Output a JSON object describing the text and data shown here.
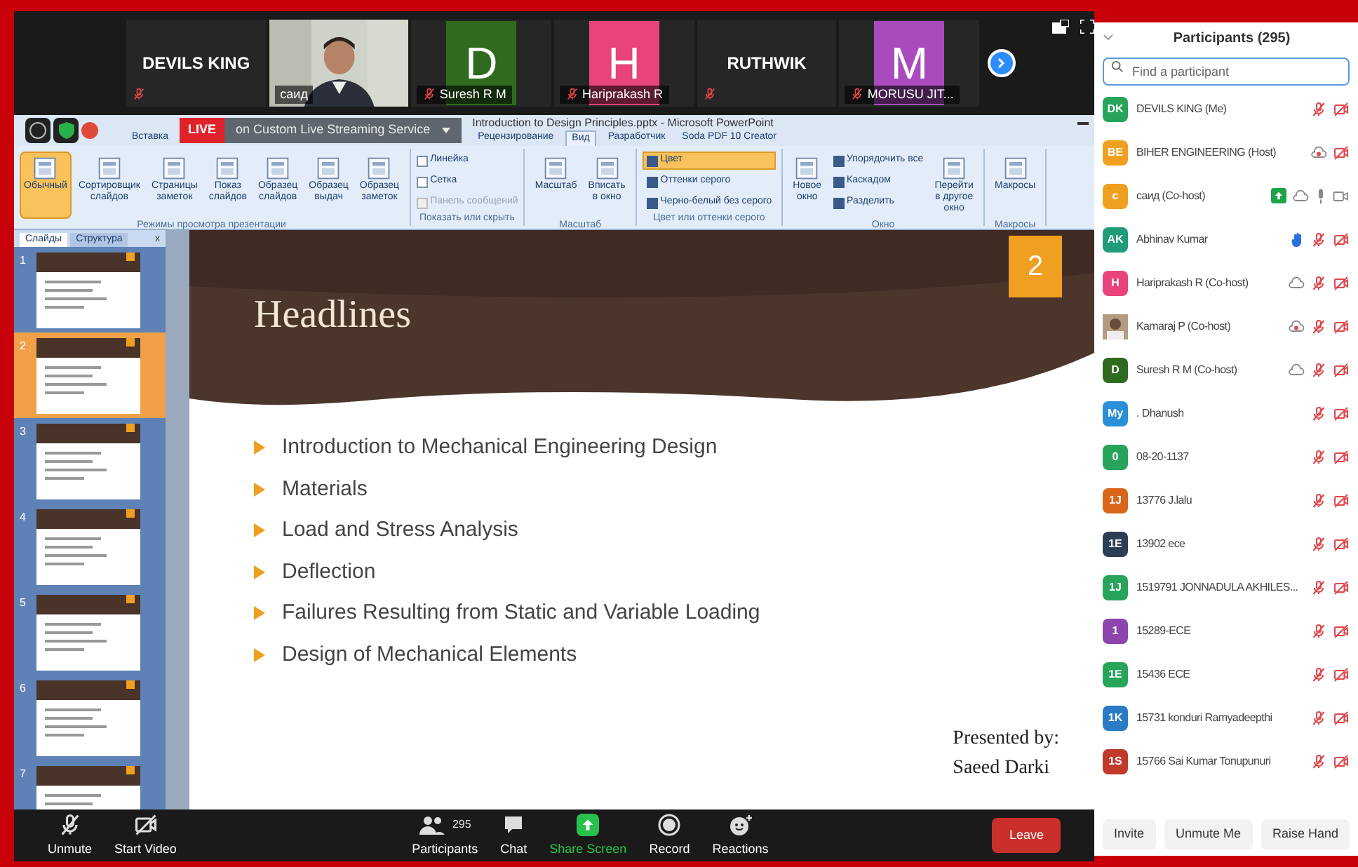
{
  "video_strip": {
    "tiles": [
      {
        "kind": "name",
        "name": "DEVILS KING",
        "muted": true
      },
      {
        "kind": "video",
        "label": "саид",
        "muted": false
      },
      {
        "kind": "letter",
        "letter": "D",
        "color": "#2e6b1e",
        "label": "Suresh R M",
        "muted": true
      },
      {
        "kind": "letter",
        "letter": "H",
        "color": "#e8437a",
        "label": "Hariprakash R",
        "muted": true
      },
      {
        "kind": "name",
        "name": "RUTHWIK",
        "muted": true
      },
      {
        "kind": "letter",
        "letter": "M",
        "color": "#a94bbd",
        "label": "MORUSU JIT...",
        "muted": true
      }
    ]
  },
  "powerpoint": {
    "title": "Introduction to Design Principles.pptx - Microsoft PowerPoint",
    "live_badge": "LIVE",
    "live_text": "on Custom Live Streaming Service",
    "tabs_before": [
      {
        "label": "Вставка",
        "selected": false
      }
    ],
    "tabs": [
      {
        "label": "Рецензирование",
        "selected": false
      },
      {
        "label": "Вид",
        "selected": true
      },
      {
        "label": "Разработчик",
        "selected": false
      },
      {
        "label": "Soda PDF 10 Creator",
        "selected": false
      }
    ],
    "ribbon": [
      {
        "label": "Режимы просмотра презентации",
        "items": [
          {
            "kind": "big",
            "label": "Обычный",
            "selected": true
          },
          {
            "kind": "big",
            "label": "Сортировщик слайдов",
            "selected": false
          },
          {
            "kind": "big",
            "label": "Страницы заметок",
            "selected": false
          },
          {
            "kind": "big",
            "label": "Показ слайдов",
            "selected": false
          },
          {
            "kind": "big",
            "label": "Образец слайдов",
            "selected": false
          },
          {
            "kind": "big",
            "label": "Образец выдач",
            "selected": false
          },
          {
            "kind": "big",
            "label": "Образец заметок",
            "selected": false
          }
        ]
      },
      {
        "label": "Показать или скрыть",
        "items": [
          {
            "kind": "check",
            "label": "Линейка",
            "checked": false,
            "disabled": false
          },
          {
            "kind": "check",
            "label": "Сетка",
            "checked": false,
            "disabled": false
          },
          {
            "kind": "check",
            "label": "Панель сообщений",
            "checked": false,
            "disabled": true
          }
        ]
      },
      {
        "label": "Масштаб",
        "items": [
          {
            "kind": "big",
            "label": "Масштаб",
            "selected": false
          },
          {
            "kind": "big",
            "label": "Вписать в окно",
            "selected": false
          }
        ]
      },
      {
        "label": "Цвет или оттенки серого",
        "items": [
          {
            "kind": "small",
            "label": "Цвет",
            "selected": true
          },
          {
            "kind": "small",
            "label": "Оттенки серого",
            "selected": false
          },
          {
            "kind": "small",
            "label": "Черно-белый без серого",
            "selected": false
          }
        ]
      },
      {
        "label": "Окно",
        "items": [
          {
            "kind": "big",
            "label": "Новое окно",
            "selected": false
          },
          {
            "kind": "small",
            "label": "Упорядочить все",
            "selected": false
          },
          {
            "kind": "small",
            "label": "Каскадом",
            "selected": false
          },
          {
            "kind": "small",
            "label": "Разделить",
            "selected": false
          },
          {
            "kind": "big",
            "label": "Перейти в другое окно",
            "selected": false
          }
        ]
      },
      {
        "label": "Макросы",
        "items": [
          {
            "kind": "big",
            "label": "Макросы",
            "selected": false
          }
        ]
      }
    ],
    "slide_panel": {
      "tabs": [
        {
          "label": "Слайды",
          "selected": true
        },
        {
          "label": "Структура",
          "selected": false
        }
      ],
      "close": "x",
      "thumbnails": [
        {
          "number": "1",
          "selected": false
        },
        {
          "number": "2",
          "selected": true
        },
        {
          "number": "3",
          "selected": false
        },
        {
          "number": "4",
          "selected": false
        },
        {
          "number": "5",
          "selected": false
        },
        {
          "number": "6",
          "selected": false
        },
        {
          "number": "7",
          "selected": false
        }
      ]
    },
    "slide": {
      "number": "2",
      "title": "Headlines",
      "bullets": [
        "Introduction to Mechanical Engineering Design",
        "Materials",
        "Load and Stress Analysis",
        "Deflection",
        "Failures Resulting from Static and Variable Loading",
        "Design of Mechanical Elements"
      ],
      "presented_by": "Presented by:",
      "author": "Saeed Darki"
    }
  },
  "toolbar": {
    "buttons": [
      {
        "kind": "unmute",
        "label": "Unmute"
      },
      {
        "kind": "video",
        "label": "Start Video"
      },
      {
        "kind": "participants",
        "label": "Participants",
        "count": "295"
      },
      {
        "kind": "chat",
        "label": "Chat"
      },
      {
        "kind": "share",
        "label": "Share Screen"
      },
      {
        "kind": "record",
        "label": "Record"
      },
      {
        "kind": "reactions",
        "label": "Reactions"
      }
    ],
    "leave": "Leave"
  },
  "participants_panel": {
    "title": "Participants (295)",
    "search": {
      "placeholder": "Find a participant"
    },
    "participants": [
      {
        "avatar": "DK",
        "color": "#27a35a",
        "name": "DEVILS KING (Me)",
        "status": [
          {
            "kind": "mic-off"
          },
          {
            "kind": "cam-off"
          }
        ]
      },
      {
        "avatar": "BE",
        "color": "#f0a020",
        "name": "BIHER ENGINEERING (Host)",
        "status": [
          {
            "kind": "rec"
          },
          {
            "kind": "cam-off"
          }
        ]
      },
      {
        "avatar": "c",
        "color": "#f0a020",
        "name": "саид (Co-host)",
        "status": [
          {
            "kind": "share"
          },
          {
            "kind": "cloud"
          },
          {
            "kind": "mic"
          },
          {
            "kind": "cam"
          }
        ]
      },
      {
        "avatar": "AK",
        "color": "#1f9c7a",
        "name": "Abhinav Kumar",
        "status": [
          {
            "kind": "hand"
          },
          {
            "kind": "mic-off"
          },
          {
            "kind": "cam-off"
          }
        ]
      },
      {
        "avatar": "H",
        "color": "#e8437a",
        "name": "Hariprakash R (Co-host)",
        "status": [
          {
            "kind": "cloud"
          },
          {
            "kind": "mic-off"
          },
          {
            "kind": "cam-off"
          }
        ]
      },
      {
        "name": "Kamaraj P (Co-host)",
        "status": [
          {
            "kind": "rec"
          },
          {
            "kind": "mic-off"
          },
          {
            "kind": "cam-off"
          }
        ]
      },
      {
        "avatar": "D",
        "color": "#2e6b1e",
        "name": "Suresh R M (Co-host)",
        "status": [
          {
            "kind": "cloud"
          },
          {
            "kind": "mic-off"
          },
          {
            "kind": "cam-off"
          }
        ]
      },
      {
        "avatar": "My",
        "color": "#2a8fd6",
        "name": ". Dhanush",
        "status": [
          {
            "kind": "mic-off"
          },
          {
            "kind": "cam-off"
          }
        ]
      },
      {
        "avatar": "0",
        "color": "#27a35a",
        "name": "08-20-1137",
        "status": [
          {
            "kind": "mic-off"
          },
          {
            "kind": "cam-off"
          }
        ]
      },
      {
        "avatar": "1J",
        "color": "#d9661a",
        "name": "13776 J.lalu",
        "status": [
          {
            "kind": "mic-off"
          },
          {
            "kind": "cam-off"
          }
        ]
      },
      {
        "avatar": "1E",
        "color": "#2c3e55",
        "name": "13902 ece",
        "status": [
          {
            "kind": "mic-off"
          },
          {
            "kind": "cam-off"
          }
        ]
      },
      {
        "avatar": "1J",
        "color": "#27a35a",
        "name": "1519791 JONNADULA AKHILES...",
        "status": [
          {
            "kind": "mic-off"
          },
          {
            "kind": "cam-off"
          }
        ]
      },
      {
        "avatar": "1",
        "color": "#8e44ad",
        "name": "15289-ECE",
        "status": [
          {
            "kind": "mic-off"
          },
          {
            "kind": "cam-off"
          }
        ]
      },
      {
        "avatar": "1E",
        "color": "#27a35a",
        "name": "15436 ECE",
        "status": [
          {
            "kind": "mic-off"
          },
          {
            "kind": "cam-off"
          }
        ]
      },
      {
        "avatar": "1K",
        "color": "#2a7bc4",
        "name": "15731 konduri Ramyadeepthi",
        "status": [
          {
            "kind": "mic-off"
          },
          {
            "kind": "cam-off"
          }
        ]
      },
      {
        "avatar": "1S",
        "color": "#c0392b",
        "name": "15766 Sai Kumar Tonupunuri",
        "status": [
          {
            "kind": "mic-off"
          },
          {
            "kind": "cam-off"
          }
        ]
      }
    ],
    "buttons": [
      "Invite",
      "Unmute Me",
      "Raise Hand"
    ]
  }
}
